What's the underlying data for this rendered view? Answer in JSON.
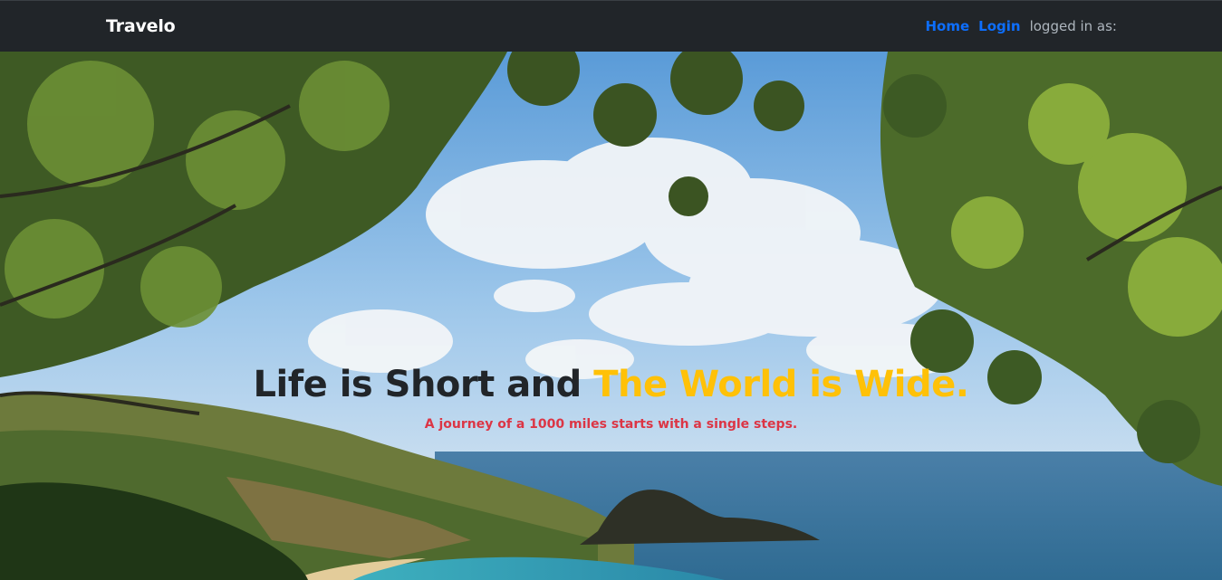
{
  "navbar": {
    "brand": "Travelo",
    "links": [
      {
        "label": "Home"
      },
      {
        "label": "Login"
      }
    ],
    "status_text": "logged in as:",
    "background": "#212529",
    "link_color": "#0d6efd"
  },
  "hero": {
    "headline_part1": "Life is Short and ",
    "headline_part2": "The World is Wide.",
    "tagline": "A journey of a 1000 miles starts with a single steps.",
    "headline_color": "#212529",
    "accent_color": "#ffc107",
    "tagline_color": "#dc3545",
    "background_image": "tropical-bay-through-trees"
  }
}
